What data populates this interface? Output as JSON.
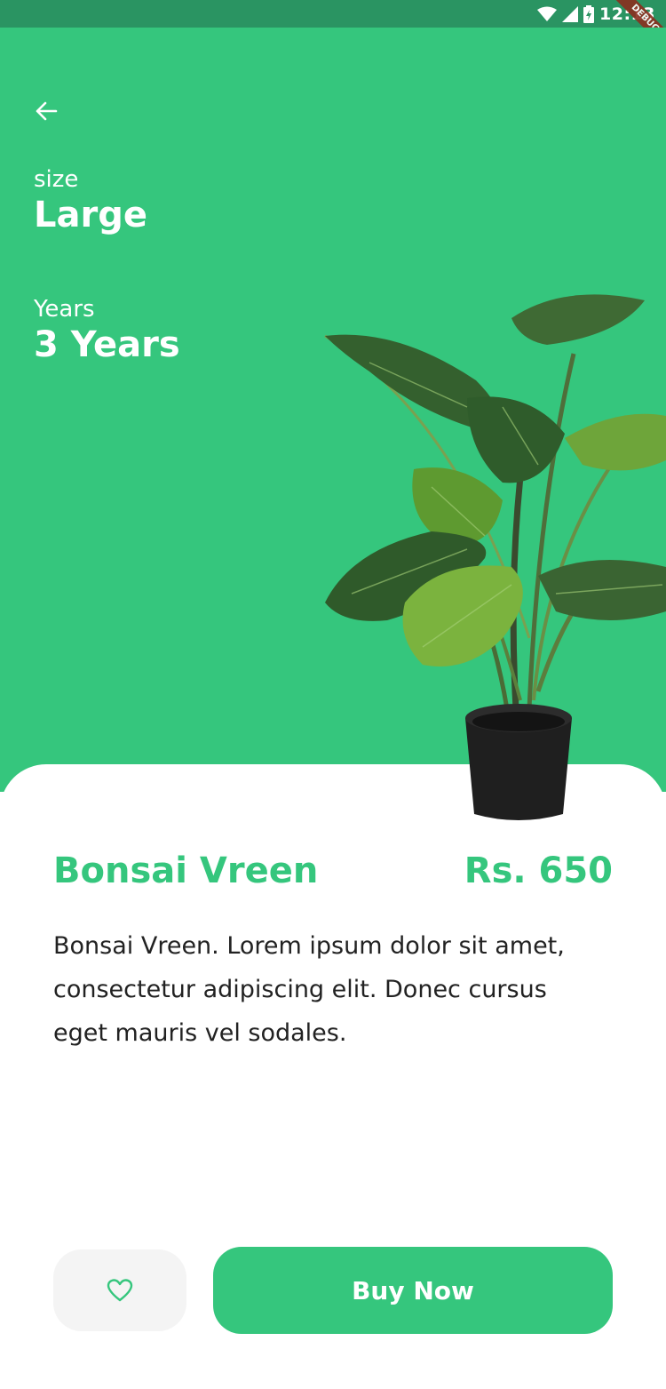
{
  "status_bar": {
    "time": "12:13",
    "banner": "DEBUG",
    "icons": [
      "wifi-icon",
      "cellular-signal-icon",
      "battery-icon"
    ]
  },
  "header": {
    "back_icon": "arrow-left-icon"
  },
  "specs": {
    "size_label": "size",
    "size_value": "Large",
    "years_label": "Years",
    "years_value": "3 Years"
  },
  "product": {
    "name": "Bonsai Vreen",
    "price": "Rs. 650",
    "description": "Bonsai Vreen. Lorem ipsum dolor sit amet, consectetur adipiscing elit. Donec cursus eget mauris vel sodales."
  },
  "actions": {
    "favorite_icon": "heart-outline-icon",
    "buy_label": "Buy Now"
  },
  "colors": {
    "primary": "#35c67d",
    "status_bar": "#2a9462",
    "favorite_bg": "#f4f4f4",
    "text": "#222222"
  }
}
